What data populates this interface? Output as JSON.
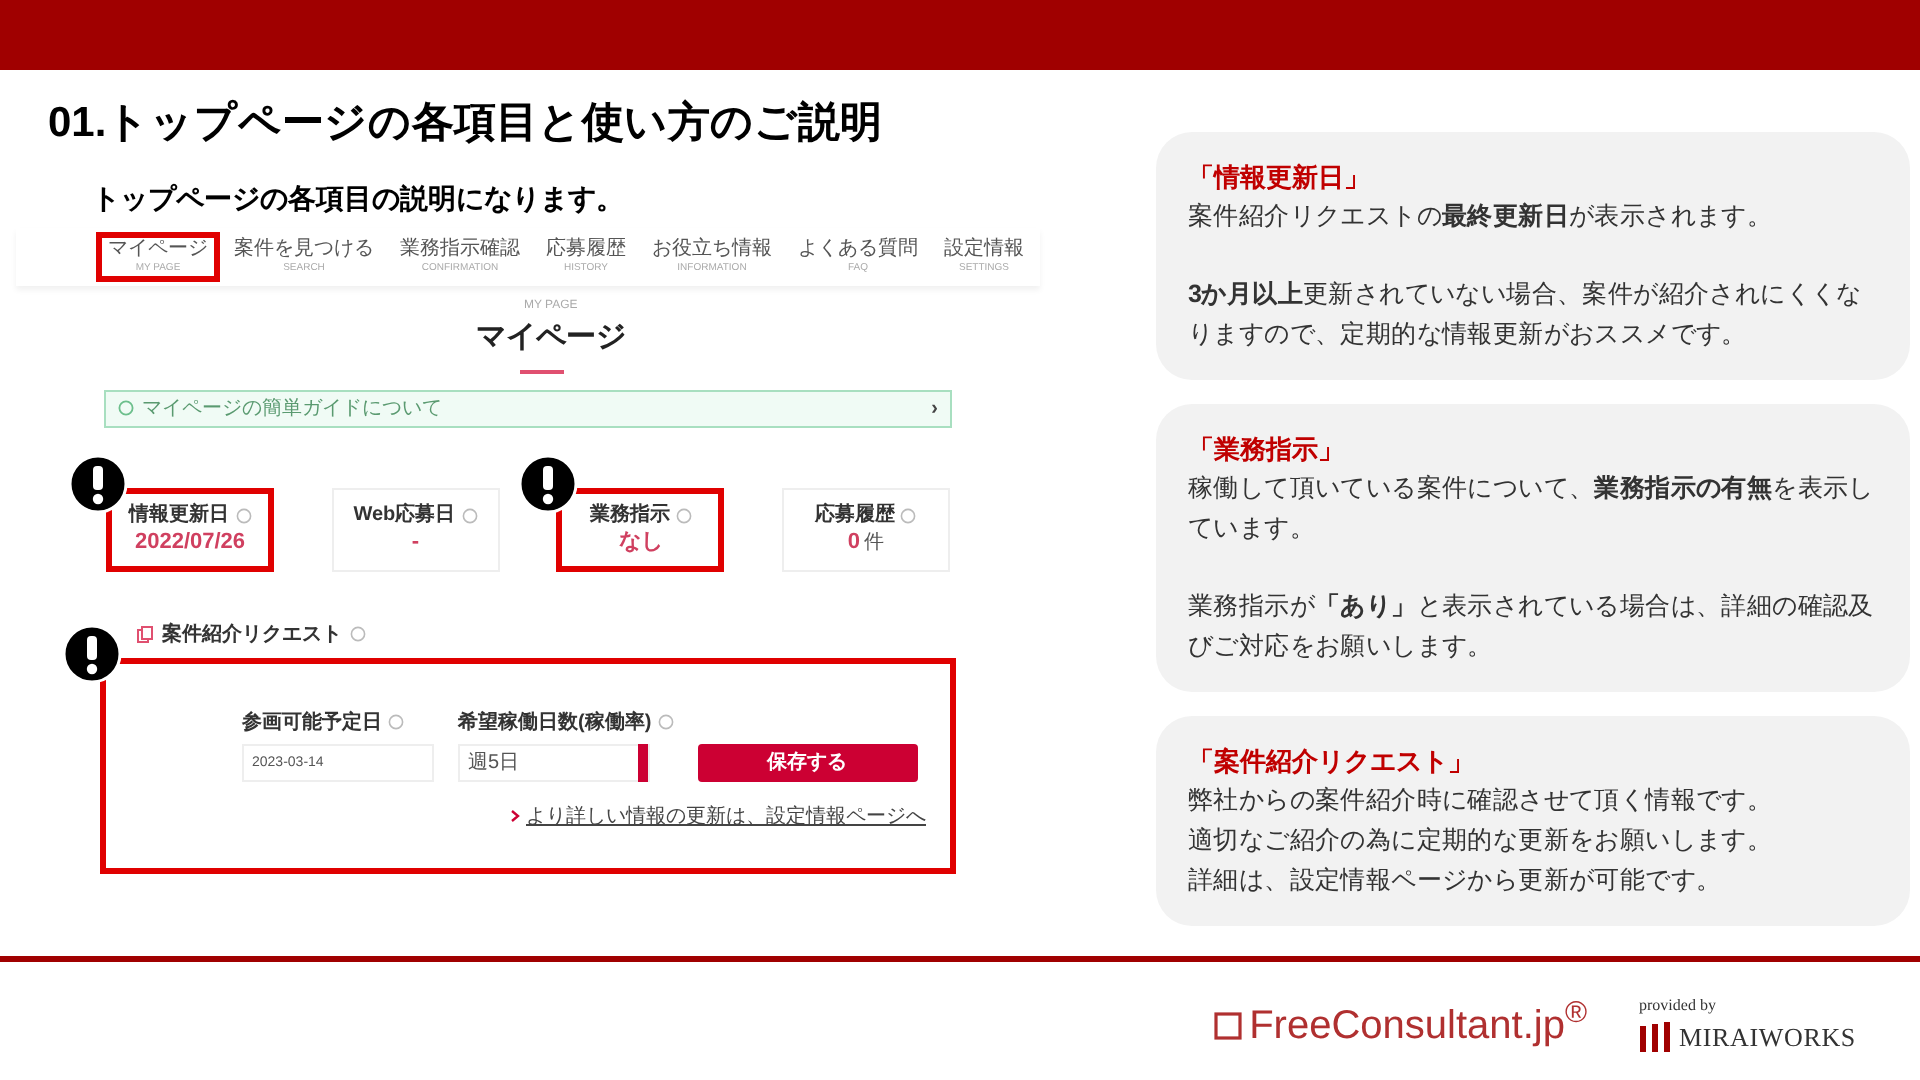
{
  "slide": {
    "title": "01.トップページの各項目と使い方のご説明",
    "subtitle": "トップページの各項目の説明になります。"
  },
  "nav": [
    {
      "label": "マイページ",
      "sub": "MY PAGE",
      "highlighted": true
    },
    {
      "label": "案件を見つける",
      "sub": "SEARCH",
      "highlighted": false
    },
    {
      "label": "業務指示確認",
      "sub": "CONFIRMATION",
      "highlighted": false
    },
    {
      "label": "応募履歴",
      "sub": "HISTORY",
      "highlighted": false
    },
    {
      "label": "お役立ち情報",
      "sub": "INFORMATION",
      "highlighted": false
    },
    {
      "label": "よくある質問",
      "sub": "FAQ",
      "highlighted": false
    },
    {
      "label": "設定情報",
      "sub": "SETTINGS",
      "highlighted": false
    }
  ],
  "page_heading": {
    "eyebrow": "MY PAGE",
    "title": "マイページ"
  },
  "guide_bar": {
    "label": "マイページの簡単ガイドについて",
    "arrow": "›"
  },
  "stats": [
    {
      "label": "情報更新日",
      "value": "2022/07/26",
      "highlighted": true
    },
    {
      "label": "Web応募日",
      "value": "-",
      "highlighted": false
    },
    {
      "label": "業務指示",
      "value": "なし",
      "highlighted": true
    },
    {
      "label": "応募履歴",
      "value": "0",
      "unit": "件",
      "highlighted": false
    }
  ],
  "request": {
    "title": "案件紹介リクエスト",
    "highlighted": true,
    "date_field": {
      "label": "参画可能予定日",
      "value": "2023-03-14"
    },
    "days_field": {
      "label": "希望稼働日数(稼働率)",
      "value": "週5日"
    },
    "save_button": "保存する",
    "link": "より詳しい情報の更新は、設定情報ページへ"
  },
  "notes": [
    {
      "heading": "「情報更新日」",
      "spaced": true,
      "paragraphs": [
        "案件紹介リクエストの**最終更新日**が表示されます。",
        "**3か月以上**更新されていない場合、案件が紹介されにくくなりますので、定期的な情報更新がおススメです。"
      ]
    },
    {
      "heading": "「業務指示」",
      "spaced": true,
      "paragraphs": [
        "稼働して頂いている案件について、**業務指示の有無**を表示しています。",
        "業務指示が**「あり」**と表示されている場合は、詳細の確認及びご対応をお願いします。"
      ]
    },
    {
      "heading": "「案件紹介リクエスト」",
      "spaced": false,
      "paragraphs": [
        "弊社からの案件紹介時に確認させて頂く情報です。",
        "適切なご紹介の為に定期的な更新をお願いします。",
        "詳細は、設定情報ページから更新が可能です。"
      ]
    }
  ],
  "footer": {
    "brand": "FreeConsultant.jp$^{®}$",
    "provided_by": "provided by",
    "company": "MIRAIWORKS"
  }
}
